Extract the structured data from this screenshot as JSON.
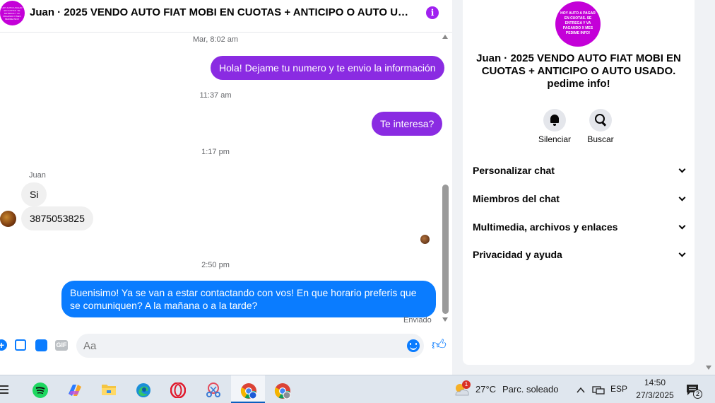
{
  "chat": {
    "avatar_text": "HOY AUTO A PAGAR EN CUOTAS. SE ENTREGA Y VA PAGANDO X MES PEDIME INFO!",
    "title": "Juan · 2025 VENDO AUTO FIAT MOBI EN CUOTAS + ANTICIPO O AUTO USADO. pedime info!",
    "messages": {
      "ts1": "Mar, 8:02 am",
      "out1": "Hola! Dejame tu numero y te envio la información",
      "ts2": "11:37 am",
      "out2": "Te interesa?",
      "ts3": "1:17 pm",
      "sender": "Juan",
      "in1": "Si",
      "in2": "3875053825",
      "ts4": "2:50 pm",
      "out3": "Buenisimo! Ya se van a estar contactando con vos! En que horario preferis que se comuniquen? A la mañana o a la tarde?",
      "status": "Enviado"
    },
    "composer": {
      "placeholder": "Aa",
      "gif_label": "GIF"
    }
  },
  "side": {
    "avatar_text": "HOY AUTO A PAGAR EN CUOTAS. SE ENTREGA Y VA PAGANDO X MES PEDIME INFO!",
    "title": "Juan · 2025 VENDO AUTO FIAT MOBI EN CUOTAS + ANTICIPO O AUTO USADO. pedime info!",
    "mute_label": "Silenciar",
    "search_label": "Buscar",
    "sections": [
      "Personalizar chat",
      "Miembros del chat",
      "Multimedia, archivos y enlaces",
      "Privacidad y ayuda"
    ]
  },
  "taskbar": {
    "weather_temp": "27°C",
    "weather_desc": "Parc. soleado",
    "weather_badge": "1",
    "language": "ESP",
    "time": "14:50",
    "date": "27/3/2025",
    "notification_count": "2"
  },
  "colors": {
    "outgoing_purple": "#8a2be2",
    "outgoing_blue": "#0a7cff",
    "accent": "#a020f0",
    "avatar_magenta": "#c400d8"
  }
}
